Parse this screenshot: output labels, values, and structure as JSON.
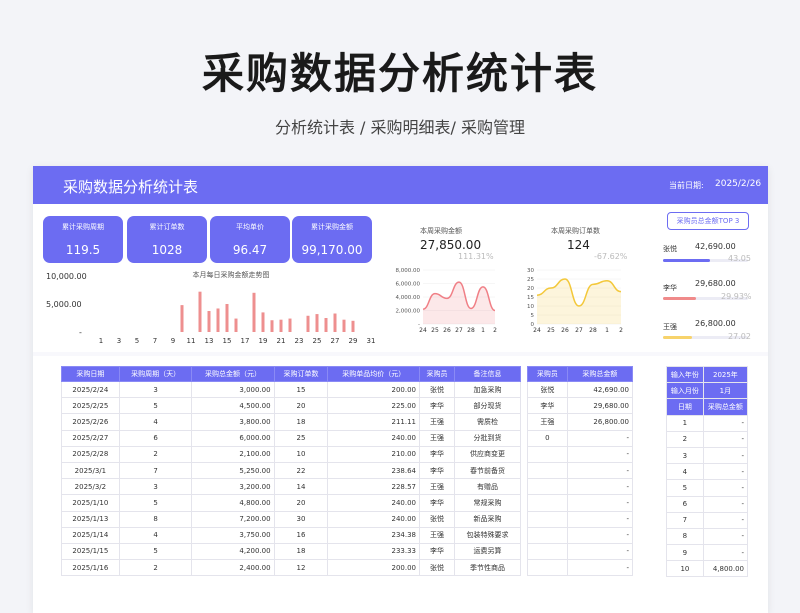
{
  "page": {
    "title": "采购数据分析统计表",
    "subtitle": "分析统计表 / 采购明细表/ 采购管理"
  },
  "header": {
    "title": "采购数据分析统计表",
    "date_label": "当前日期:",
    "date": "2025/2/26"
  },
  "kpis": [
    {
      "label": "累计采购周期",
      "value": "119.5"
    },
    {
      "label": "累计订单数",
      "value": "1028"
    },
    {
      "label": "平均单价",
      "value": "96.47"
    },
    {
      "label": "累计采购金额",
      "value": "99,170.00"
    }
  ],
  "bar_chart_labels": {
    "title": "本月每日采购金额走势图",
    "y_top": "10,000.00",
    "y_mid": "5,000.00",
    "y_bottom": "-"
  },
  "week_amount": {
    "title": "本周采购金额",
    "value": "27,850.00",
    "pct": "111.31%"
  },
  "week_orders": {
    "title": "本周采购订单数",
    "value": "124",
    "pct": "-67.62%"
  },
  "top3": {
    "title": "采购员总金额TOP 3",
    "items": [
      {
        "name": "张悦",
        "value": "42,690.00",
        "pct": "43.05",
        "share": 0.4305,
        "color": "#6c6cf2"
      },
      {
        "name": "李华",
        "value": "29,680.00",
        "pct": "29.93%",
        "share": 0.2993,
        "color": "#f08a8a"
      },
      {
        "name": "王强",
        "value": "26,800.00",
        "pct": "27.02",
        "share": 0.2702,
        "color": "#f7d36b"
      }
    ]
  },
  "chart_data": [
    {
      "type": "bar",
      "title": "本月每日采购金额走势图",
      "categories": [
        "1",
        "2",
        "3",
        "4",
        "5",
        "6",
        "7",
        "8",
        "9",
        "10",
        "11",
        "12",
        "13",
        "14",
        "15",
        "16",
        "17",
        "18",
        "19",
        "20",
        "21",
        "22",
        "23",
        "24",
        "25",
        "26",
        "27",
        "28",
        "29",
        "30",
        "31"
      ],
      "x_tick_labels": [
        "1",
        "3",
        "5",
        "7",
        "9",
        "11",
        "13",
        "15",
        "17",
        "19",
        "21",
        "23",
        "25",
        "27",
        "29",
        "31"
      ],
      "values": [
        0,
        0,
        0,
        0,
        0,
        0,
        0,
        0,
        0,
        4800,
        0,
        7200,
        3750,
        4200,
        5000,
        2400,
        0,
        7000,
        3500,
        2100,
        2200,
        2400,
        0,
        2900,
        3200,
        2500,
        3300,
        2200,
        2000,
        0,
        0
      ],
      "ylim": [
        0,
        10000
      ],
      "y_ticks": [
        "10,000.00",
        "5,000.00",
        "-"
      ],
      "color": "#ee8f8f"
    },
    {
      "type": "area",
      "title": "本周采购金额",
      "categories": [
        "24",
        "25",
        "26",
        "27",
        "28",
        "1",
        "2"
      ],
      "values": [
        2200,
        4500,
        3800,
        6200,
        2300,
        5500,
        2000
      ],
      "ylim": [
        0,
        8000
      ],
      "y_ticks": [
        "8,000.00",
        "6,000.00",
        "4,000.00",
        "2,000.00",
        "-"
      ],
      "color": "#f07f86"
    },
    {
      "type": "area",
      "title": "本周采购订单数",
      "categories": [
        "24",
        "25",
        "26",
        "27",
        "28",
        "1",
        "2"
      ],
      "values": [
        16,
        20,
        25,
        10,
        22,
        24,
        18
      ],
      "ylim": [
        0,
        30
      ],
      "y_ticks": [
        "30",
        "25",
        "20",
        "15",
        "10",
        "5",
        "0"
      ],
      "color": "#f3c83b"
    }
  ],
  "detail_table": {
    "headers": [
      "采购日期",
      "采购周期（天）",
      "采购总金额（元）",
      "采购订单数",
      "采购单品均价（元）",
      "采购员",
      "备注信息"
    ],
    "rows": [
      [
        "2025/2/24",
        "3",
        "3,000.00",
        "15",
        "200.00",
        "张悦",
        "加急采购"
      ],
      [
        "2025/2/25",
        "5",
        "4,500.00",
        "20",
        "225.00",
        "李华",
        "部分现货"
      ],
      [
        "2025/2/26",
        "4",
        "3,800.00",
        "18",
        "211.11",
        "王强",
        "需质检"
      ],
      [
        "2025/2/27",
        "6",
        "6,000.00",
        "25",
        "240.00",
        "王强",
        "分批到货"
      ],
      [
        "2025/2/28",
        "2",
        "2,100.00",
        "10",
        "210.00",
        "李华",
        "供应商变更"
      ],
      [
        "2025/3/1",
        "7",
        "5,250.00",
        "22",
        "238.64",
        "李华",
        "春节前备货"
      ],
      [
        "2025/3/2",
        "3",
        "3,200.00",
        "14",
        "228.57",
        "王强",
        "有赠品"
      ],
      [
        "2025/1/10",
        "5",
        "4,800.00",
        "20",
        "240.00",
        "李华",
        "常规采购"
      ],
      [
        "2025/1/13",
        "8",
        "7,200.00",
        "30",
        "240.00",
        "张悦",
        "新品采购"
      ],
      [
        "2025/1/14",
        "4",
        "3,750.00",
        "16",
        "234.38",
        "王强",
        "包装特殊要求"
      ],
      [
        "2025/1/15",
        "5",
        "4,200.00",
        "18",
        "233.33",
        "李华",
        "运费另算"
      ],
      [
        "2025/1/16",
        "2",
        "2,400.00",
        "12",
        "200.00",
        "张悦",
        "季节性商品"
      ]
    ]
  },
  "buyer_table": {
    "headers": [
      "采购员",
      "采购总金额"
    ],
    "rows": [
      [
        "张悦",
        "42,690.00"
      ],
      [
        "李华",
        "29,680.00"
      ],
      [
        "王强",
        "26,800.00"
      ],
      [
        "0",
        "-"
      ],
      [
        "",
        "-"
      ],
      [
        "",
        "-"
      ],
      [
        "",
        "-"
      ],
      [
        "",
        "-"
      ],
      [
        "",
        "-"
      ],
      [
        "",
        "-"
      ],
      [
        "",
        "-"
      ],
      [
        "",
        "-"
      ]
    ]
  },
  "month_table": {
    "year_label": "输入年份",
    "year": "2025年",
    "month_label": "输入月份",
    "month": "1月",
    "headers": [
      "日期",
      "采购总金额"
    ],
    "rows": [
      [
        "1",
        "-"
      ],
      [
        "2",
        "-"
      ],
      [
        "3",
        "-"
      ],
      [
        "4",
        "-"
      ],
      [
        "5",
        "-"
      ],
      [
        "6",
        "-"
      ],
      [
        "7",
        "-"
      ],
      [
        "8",
        "-"
      ],
      [
        "9",
        "-"
      ],
      [
        "10",
        "4,800.00"
      ]
    ]
  }
}
